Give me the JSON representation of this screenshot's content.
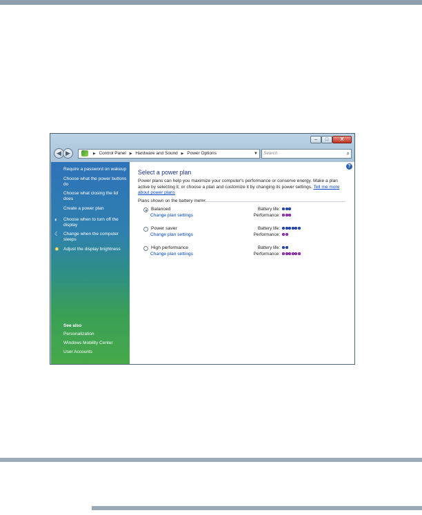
{
  "window": {
    "minimize_glyph": "–",
    "maximize_glyph": "□",
    "close_glyph": "X"
  },
  "navbar": {
    "back_glyph": "◀",
    "forward_glyph": "▶",
    "breadcrumb": [
      "Control Panel",
      "Hardware and Sound",
      "Power Options"
    ],
    "refresh_glyph": "↻",
    "search_placeholder": "Search"
  },
  "sidebar": {
    "tasks": [
      {
        "label": "Require a password on wakeup",
        "icon": null
      },
      {
        "label": "Choose what the power buttons do",
        "icon": null
      },
      {
        "label": "Choose what closing the lid does",
        "icon": null
      },
      {
        "label": "Create a power plan",
        "icon": null
      },
      {
        "label": "Choose when to turn off the display",
        "icon": "display-icon"
      },
      {
        "label": "Change when the computer sleeps",
        "icon": "moon-icon"
      },
      {
        "label": "Adjust the display brightness",
        "icon": "sun-icon"
      }
    ],
    "see_also_title": "See also",
    "see_also": [
      "Personalization",
      "Windows Mobility Center",
      "User Accounts"
    ]
  },
  "main": {
    "title": "Select a power plan",
    "description": "Power plans can help you maximize your computer's performance or conserve energy. Make a plan active by selecting it, or choose a plan and customize it by changing its power settings.",
    "description_link": "Tell me more about power plans",
    "section_label": "Plans shown on the battery meter",
    "plans": [
      {
        "name": "Balanced",
        "selected": true,
        "link": "Change plan settings",
        "battery_label": "Battery life:",
        "battery_level": 3,
        "performance_label": "Performance:",
        "performance_level": 3
      },
      {
        "name": "Power saver",
        "selected": false,
        "link": "Change plan settings",
        "battery_label": "Battery life:",
        "battery_level": 6,
        "performance_label": "Performance:",
        "performance_level": 2
      },
      {
        "name": "High performance",
        "selected": false,
        "link": "Change plan settings",
        "battery_label": "Battery life:",
        "battery_level": 2,
        "performance_label": "Performance:",
        "performance_level": 6
      }
    ]
  },
  "colors": {
    "battery_dot": "#2a54d6",
    "performance_dot": "#b63bd3",
    "title_blue": "#1e3287",
    "link_blue": "#0044cc"
  }
}
